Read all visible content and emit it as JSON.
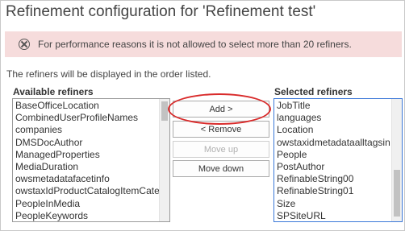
{
  "title": "Refinement configuration for 'Refinement test'",
  "error": {
    "icon": "error-circle-x-icon",
    "message": "For performance reasons it is not allowed to select more than 20 refiners."
  },
  "note": "The refiners will be displayed in the order listed.",
  "available": {
    "heading": "Available refiners",
    "items": [
      "BaseOfficeLocation",
      "CombinedUserProfileNames",
      "companies",
      "DMSDocAuthor",
      "ManagedProperties",
      "MediaDuration",
      "owsmetadatafacetinfo",
      "owstaxIdProductCatalogItemCatego",
      "PeopleInMedia",
      "PeopleKeywords"
    ]
  },
  "selected": {
    "heading": "Selected refiners",
    "items": [
      "JobTitle",
      "languages",
      "Location",
      "owstaxidmetadataalltagsin",
      "People",
      "PostAuthor",
      "RefinableString00",
      "RefinableString01",
      "Size",
      "SPSiteURL"
    ]
  },
  "buttons": {
    "add": "Add >",
    "remove": "< Remove",
    "move_up": "Move up",
    "move_down": "Move down"
  },
  "colors": {
    "error_background": "#f6dcdc",
    "highlight": "#d92b2b",
    "selected_border": "#3b78d8"
  }
}
